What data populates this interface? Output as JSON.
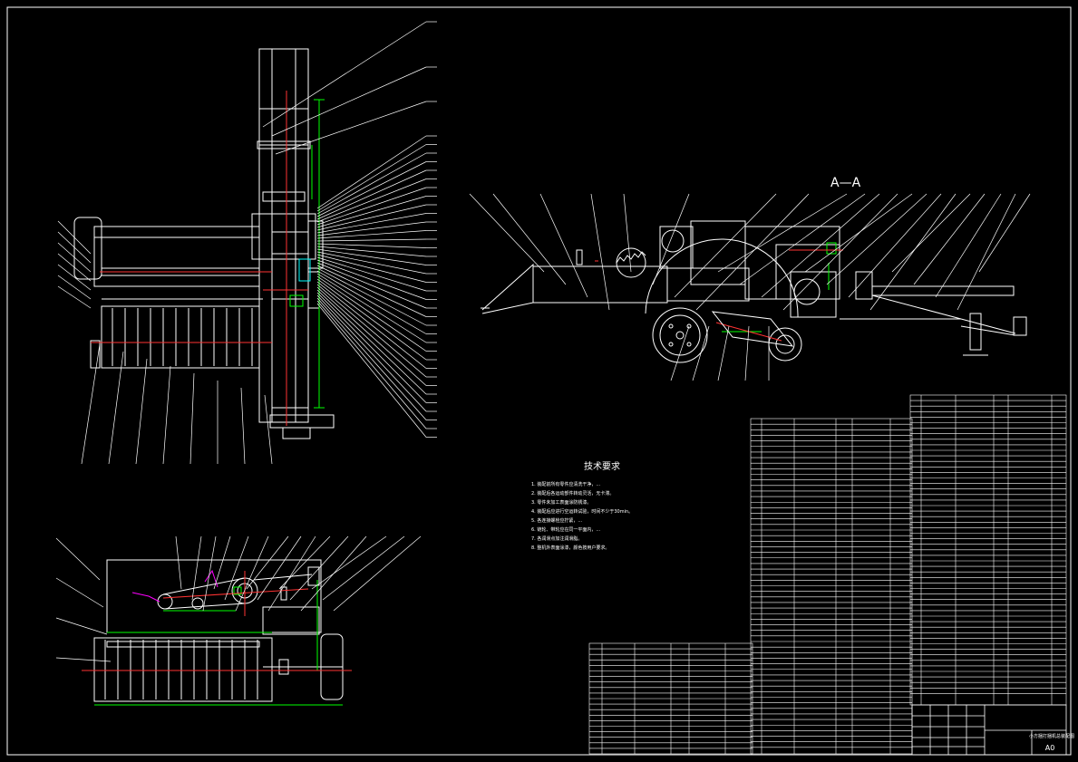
{
  "sheet": {
    "size_label": "A0",
    "section_label": "A—A",
    "colors": {
      "background": "#000000",
      "outline": "#ffffff",
      "dimension": "#00ff00",
      "centerline": "#ff3333",
      "leader": "#ffffff",
      "hidden": "#ff00ff",
      "highlight": "#00ffff"
    }
  },
  "notes": {
    "heading": "技术要求",
    "lines": [
      "1. 装配前所有零件应清洗干净，...",
      "2. 装配后各运动部件转动灵活，无卡滞。",
      "3. 零件未加工表面涂防锈漆。",
      "4. 装配后应进行空运转试验，时间不少于30min。",
      "5. 各连接螺栓应拧紧，...",
      "6. 链轮、带轮应在同一平面内，...",
      "7. 各润滑点加注润滑脂。",
      "8. 整机外表面涂漆，颜色按用户要求。"
    ]
  },
  "title_block": {
    "label": "小方捆打捆机总装配图",
    "scale": "A0"
  }
}
